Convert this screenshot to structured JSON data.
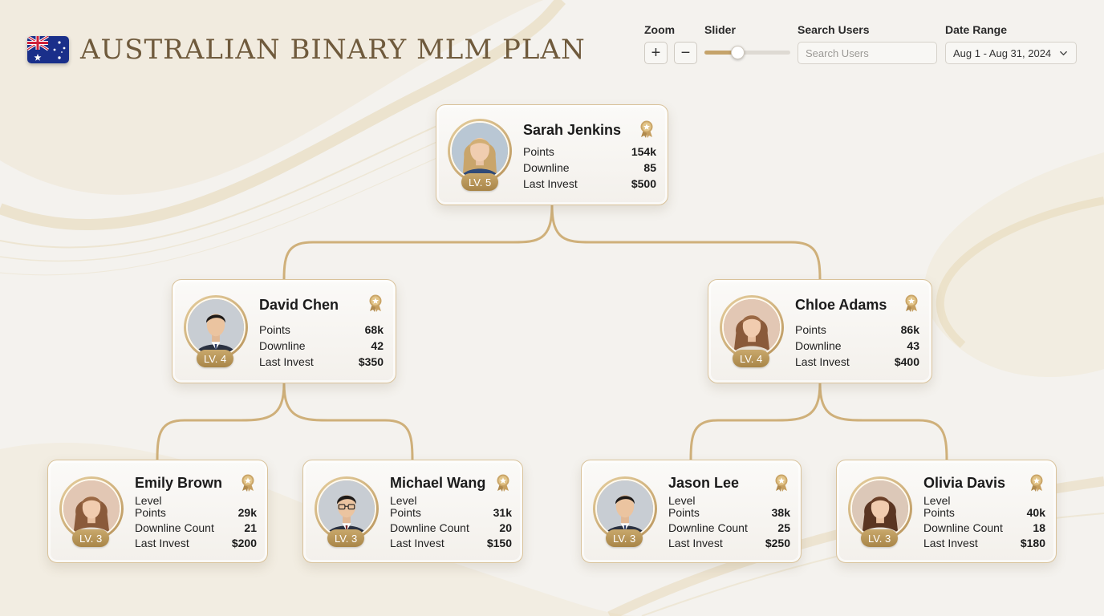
{
  "header": {
    "title": "AUSTRALIAN BINARY MLM PLAN",
    "flag_icon": "australia-flag-icon"
  },
  "controls": {
    "zoom_label": "Zoom",
    "zoom_in": "+",
    "zoom_out": "−",
    "slider_label": "Slider",
    "slider_value_fraction": 0.38,
    "search_label": "Search Users",
    "search_placeholder": "Search Users",
    "date_label": "Date Range",
    "date_value": "Aug 1 - Aug 31, 2024"
  },
  "colors": {
    "accent_gold": "#c5a36a",
    "card_border": "#d9c29a",
    "title": "#6f5a3c"
  },
  "tree": {
    "root": {
      "name": "Sarah Jenkins",
      "level": "LV. 5",
      "stats": [
        {
          "k": "Points",
          "v": "154k"
        },
        {
          "k": "Downline",
          "v": "85"
        },
        {
          "k": "Last Invest",
          "v": "$500"
        }
      ]
    },
    "left": {
      "name": "David Chen",
      "level": "LV. 4",
      "stats": [
        {
          "k": "Points",
          "v": "68k"
        },
        {
          "k": "Downline",
          "v": "42"
        },
        {
          "k": "Last Invest",
          "v": "$350"
        }
      ]
    },
    "right": {
      "name": "Chloe Adams",
      "level": "LV. 4",
      "stats": [
        {
          "k": "Points",
          "v": "86k"
        },
        {
          "k": "Downline",
          "v": "43"
        },
        {
          "k": "Last Invest",
          "v": "$400"
        }
      ]
    },
    "leaves": [
      {
        "name": "Emily Brown",
        "level": "LV. 3",
        "level_label": "Level",
        "stats": [
          {
            "k": "Points",
            "v": "29k"
          },
          {
            "k": "Downline Count",
            "v": "21"
          },
          {
            "k": "Last Invest",
            "v": "$200"
          }
        ]
      },
      {
        "name": "Michael Wang",
        "level": "LV. 3",
        "level_label": "Level",
        "stats": [
          {
            "k": "Points",
            "v": "31k"
          },
          {
            "k": "Downline Count",
            "v": "20"
          },
          {
            "k": "Last Invest",
            "v": "$150"
          }
        ]
      },
      {
        "name": "Jason Lee",
        "level": "LV. 3",
        "level_label": "Level",
        "stats": [
          {
            "k": "Points",
            "v": "38k"
          },
          {
            "k": "Downline Count",
            "v": "25"
          },
          {
            "k": "Last Invest",
            "v": "$250"
          }
        ]
      },
      {
        "name": "Olivia Davis",
        "level": "LV. 3",
        "level_label": "Level",
        "stats": [
          {
            "k": "Points",
            "v": "40k"
          },
          {
            "k": "Downline Count",
            "v": "18"
          },
          {
            "k": "Last Invest",
            "v": "$180"
          }
        ]
      }
    ]
  }
}
